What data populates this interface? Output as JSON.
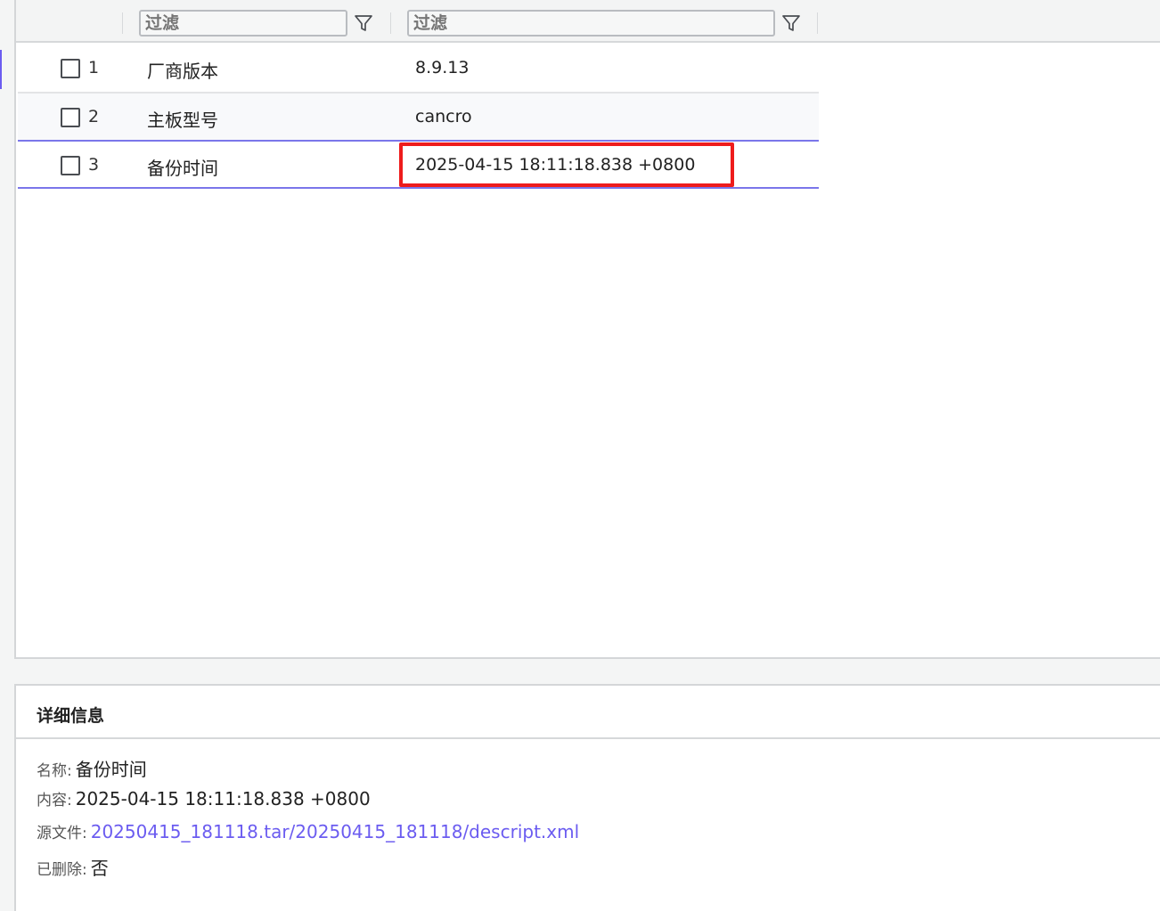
{
  "filters": [
    {
      "placeholder": "过滤"
    },
    {
      "placeholder": "过滤"
    }
  ],
  "rows": [
    {
      "num": "1",
      "name": "厂商版本",
      "value": "8.9.13"
    },
    {
      "num": "2",
      "name": "主板型号",
      "value": "cancro"
    },
    {
      "num": "3",
      "name": "备份时间",
      "value": "2025-04-15 18:11:18.838 +0800"
    }
  ],
  "details": {
    "title": "详细信息",
    "name_label": "名称:",
    "name_value": "备份时间",
    "content_label": "内容:",
    "content_value": "2025-04-15 18:11:18.838 +0800",
    "source_label": "源文件:",
    "source_value": "20250415_181118.tar/20250415_181118/descript.xml",
    "deleted_label": "已删除:",
    "deleted_value": "否"
  },
  "colors": {
    "accent": "#6b5cf0",
    "highlight": "#ee1c1c",
    "selection_border": "#7a76ea"
  },
  "icons": [
    "filter-icon",
    "checkbox-icon"
  ]
}
